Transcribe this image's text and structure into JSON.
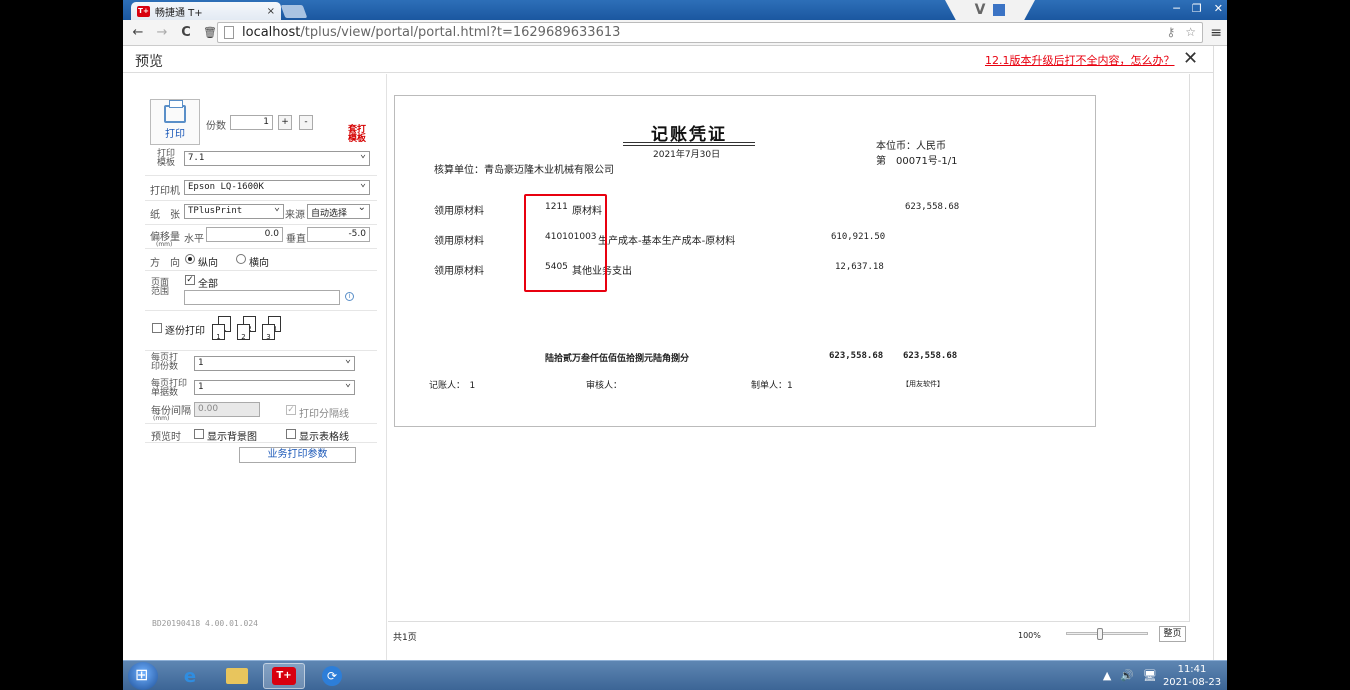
{
  "browser": {
    "tab_title": "畅捷通 T+",
    "tab_logo": "T+",
    "tab_close": "×",
    "url_host": "localhost",
    "url_path": "/tplus/view/portal/portal.html?t=1629689633613",
    "nav_back": "←",
    "nav_forward": "→",
    "nav_reload": "C",
    "nav_clear": "🗑",
    "menu_glyph": "≡",
    "ext_v": "V",
    "ext_icon": "qr-icon",
    "win_min": "─",
    "win_restore": "❐",
    "win_close": "✕",
    "omni_icons": [
      "key-icon",
      "star-icon"
    ]
  },
  "preview": {
    "title": "预览",
    "help_link": "12.1版本升级后打不全内容，怎么办？",
    "close_glyph": "✕"
  },
  "panel": {
    "print_label": "打印",
    "copies_label": "份数",
    "copies_value": "1",
    "plus": "+",
    "minus": "-",
    "template_label": "打印模板",
    "template_value": "7.1",
    "custom_template": "套打模板",
    "printer_label": "打印机",
    "printer_value": "Epson LQ-1600K",
    "paper_label": "纸　张",
    "paper_value": "TPlusPrint",
    "source_label": "来源",
    "source_value": "自动选择",
    "offset_label": "偏移量",
    "offset_unit": "(mm)",
    "horizontal_label": "水平",
    "horizontal_value": "0.0",
    "vertical_label": "垂直",
    "vertical_value": "-5.0",
    "direction_label": "方　向",
    "portrait_label": "纵向",
    "landscape_label": "横向",
    "page_range_label": "页面范围",
    "all_label": "全部",
    "page_range_value": "",
    "copy_by_copy_label": "逐份打印",
    "page_icons": [
      "1",
      "2",
      "3"
    ],
    "per_page_copies_label": "每页打印份数",
    "per_page_copies_value": "1",
    "per_page_docs_label": "每页打印单据数",
    "per_page_docs_value": "1",
    "gap_label": "每份间隔",
    "gap_unit": "(mm)",
    "gap_value": "0.00",
    "separator_label": "打印分隔线",
    "preview_label": "预览时",
    "show_bg_label": "显示背景图",
    "show_grid_label": "显示表格线",
    "business_params": "业务打印参数",
    "version": "BD20190418 4.00.01.024"
  },
  "voucher": {
    "title": "记账凭证",
    "date": "2021年7月30日",
    "currency": "本位币：人民币",
    "number": "第　00071号-1/1",
    "unit": "核算单位：青岛豪迈隆木业机械有限公司",
    "rows": [
      {
        "summary": "领用原材料",
        "code": "1211",
        "account": "原材料",
        "debit": "",
        "credit": "623,558.68"
      },
      {
        "summary": "领用原材料",
        "code": "410101003",
        "account": "生产成本-基本生产成本-原材料",
        "debit": "610,921.50",
        "credit": ""
      },
      {
        "summary": "领用原材料",
        "code": "5405",
        "account": "其他业务支出",
        "debit": "12,637.18",
        "credit": ""
      }
    ],
    "total_words": "陆拾贰万叁仟伍佰伍拾捌元陆角捌分",
    "total_debit": "623,558.68",
    "total_credit": "623,558.68",
    "bookkeeper": "记账人：　1",
    "reviewer": "审核人：",
    "maker": "制单人：1",
    "brand": "【用友软件】"
  },
  "footer": {
    "total_pages": "共1页",
    "zoom": "100%",
    "zoom_fraction": 0.4,
    "fit_btn": "整页"
  },
  "taskbar": {
    "time": "11:41",
    "date": "2021-08-23",
    "tplus": "T+",
    "ie": "e",
    "app_glyph": "⟳",
    "tray": [
      "▲",
      "🔊",
      "🖥"
    ]
  }
}
